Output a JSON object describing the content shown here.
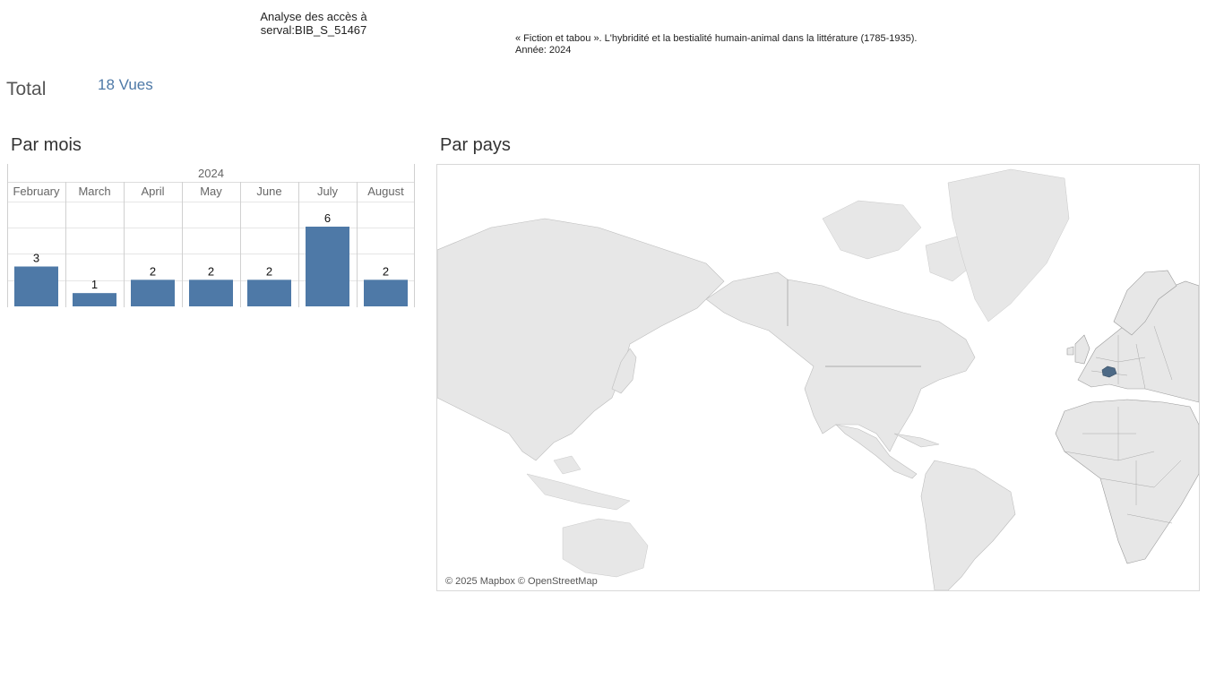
{
  "header": {
    "title_line1": "Analyse des accès à",
    "title_line2": "serval:BIB_S_51467"
  },
  "document": {
    "title": "« Fiction et tabou ». L'hybridité et la bestialité humain-animal dans la littérature (1785-1935).",
    "year_line": "Année: 2024"
  },
  "total": {
    "label": "Total",
    "value": "18 Vues"
  },
  "sections": {
    "by_month": "Par mois",
    "by_country": "Par pays"
  },
  "colors": {
    "bar": "#4e79a7",
    "highlight_country": "#4e6a86",
    "land": "#e7e7e7",
    "border": "#9a9a9a",
    "grid": "#e6e6e6"
  },
  "chart_data": {
    "type": "bar",
    "year_header": "2024",
    "categories": [
      "February",
      "March",
      "April",
      "May",
      "June",
      "July",
      "August"
    ],
    "values": [
      3,
      1,
      2,
      2,
      2,
      6,
      2
    ],
    "ylim": [
      0,
      6.5
    ],
    "grid": true
  },
  "map": {
    "highlighted_country": "Switzerland",
    "attribution": "© 2025 Mapbox © OpenStreetMap"
  }
}
